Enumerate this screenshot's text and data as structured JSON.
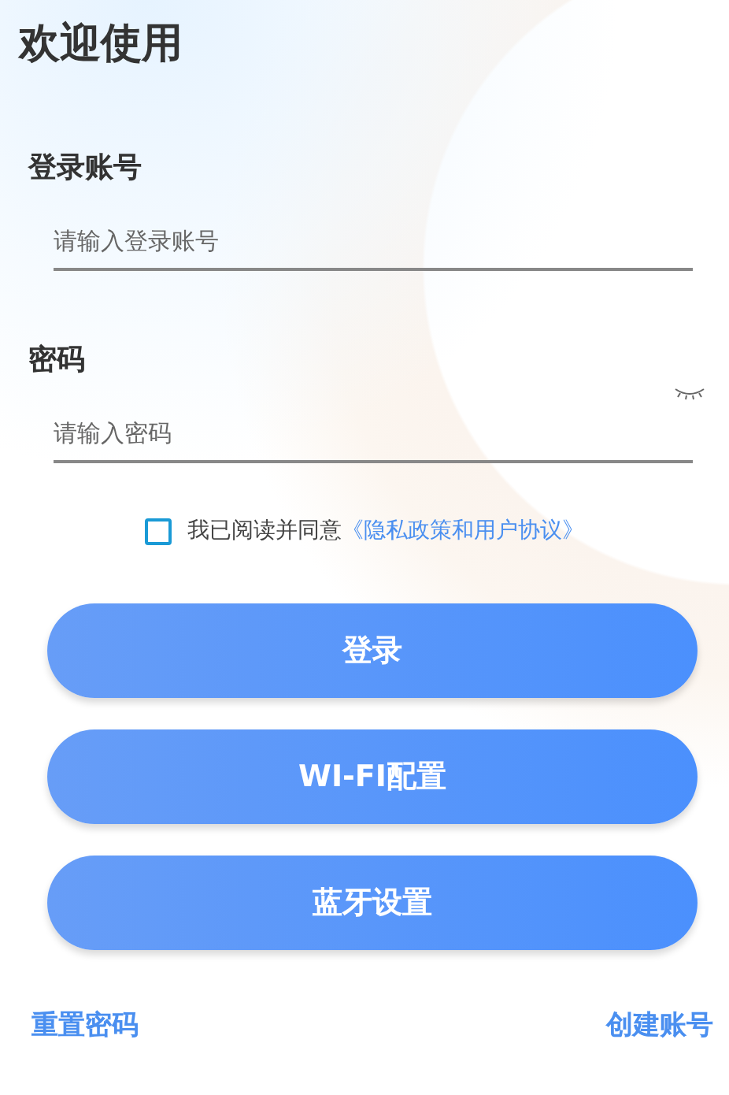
{
  "title": "欢迎使用",
  "fields": [
    {
      "label": "登录账号",
      "placeholder": "请输入登录账号",
      "kind": "text"
    },
    {
      "label": "密码",
      "placeholder": "请输入密码",
      "kind": "password"
    }
  ],
  "agreement": {
    "checked": false,
    "text": "我已阅读并同意",
    "link": "《隐私政策和用户协议》"
  },
  "buttons": [
    "登录",
    "WI-FI配置",
    "蓝牙设置"
  ],
  "footer_links": [
    "重置密码",
    "创建账号"
  ]
}
